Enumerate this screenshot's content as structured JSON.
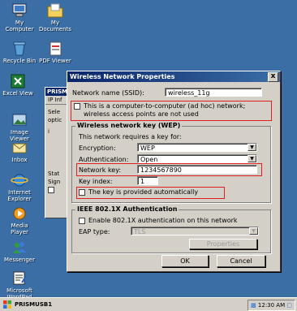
{
  "desktop": {
    "icons": [
      {
        "label": "My Computer"
      },
      {
        "label": "My Documents"
      },
      {
        "label": "Recycle Bin"
      },
      {
        "label": "PDF Viewer"
      },
      {
        "label": "Excel View"
      },
      {
        "label": "Image Viewer"
      },
      {
        "label": "Inbox"
      },
      {
        "label": "Internet Explorer"
      },
      {
        "label": "Media Player"
      },
      {
        "label": "Messenger"
      },
      {
        "label": "Microsoft WordPad"
      }
    ]
  },
  "background_window": {
    "title": "PRISM",
    "tab": "IP Inf",
    "lines": [
      "Sele",
      "optic",
      "i",
      "Stat",
      "Sign"
    ]
  },
  "dialog": {
    "title": "Wireless Network Properties",
    "close_label": "x",
    "ssid_label": "Network name (SSID):",
    "ssid_value": "wireless_11g",
    "adhoc_label_line1": "This is a computer-to-computer (ad hoc) network;",
    "adhoc_label_line2": "wireless access points are not used",
    "wep_group_title": "Wireless network key (WEP)",
    "requires_text": "This network requires a key for:",
    "encryption_label": "Encryption:",
    "encryption_value": "WEP",
    "authentication_label": "Authentication:",
    "authentication_value": "Open",
    "network_key_label": "Network key:",
    "network_key_value": "1234567890",
    "key_index_label": "Key index:",
    "key_index_value": "1",
    "key_auto_label": "The key is provided automatically",
    "ieee_group_title": "IEEE 802.1X Authentication",
    "enable_8021x_label": "Enable 802.1X authentication on this network",
    "eap_type_label": "EAP type:",
    "eap_type_value": "TLS",
    "properties_label": "Properties",
    "ok_label": "OK",
    "cancel_label": "Cancel"
  },
  "taskbar": {
    "task_label": "PRISMUSB1",
    "clock": "12:30 AM"
  },
  "colors": {
    "desktop": "#3a6ea5",
    "titlebar": "#0a246a",
    "highlight_box": "#e02020"
  }
}
